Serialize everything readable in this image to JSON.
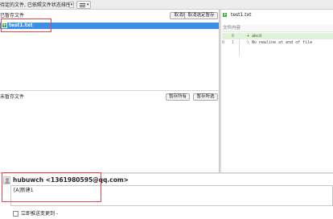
{
  "toolbar": {
    "filter_text": "待定的文件, 已依照文件状态排序",
    "dropdown_glyph": "▾",
    "view_caret": "▾"
  },
  "staged": {
    "title": "已暂存文件",
    "buttons": {
      "unstage_all": "取消所有暂存",
      "unstage_selected": "取消选定暂存"
    },
    "files": [
      {
        "name": "test1.txt",
        "status_icon": "file-added-icon",
        "status_glyph": "+"
      }
    ]
  },
  "unstaged": {
    "title": "未暂存文件",
    "buttons": {
      "stage_all": "暂存所有",
      "stage_selected": "暂存所选"
    }
  },
  "diff": {
    "file": "test1.txt",
    "file_glyph": "+",
    "section": "文件内容",
    "lines": [
      {
        "old": "0",
        "new": "",
        "text": "+ abcd",
        "kind": "add"
      },
      {
        "old": "1",
        "new": "0",
        "text": "\\  No newline at end of file",
        "kind": "plain"
      }
    ]
  },
  "commit": {
    "author": "hubuwch <1361980595@qq.com>",
    "message": "[A]新建1",
    "push_label": "立即推送变更到 -"
  },
  "colors": {
    "selection": "#3d8ee6",
    "added": "#3aa83a",
    "annotation": "#e2474f"
  }
}
